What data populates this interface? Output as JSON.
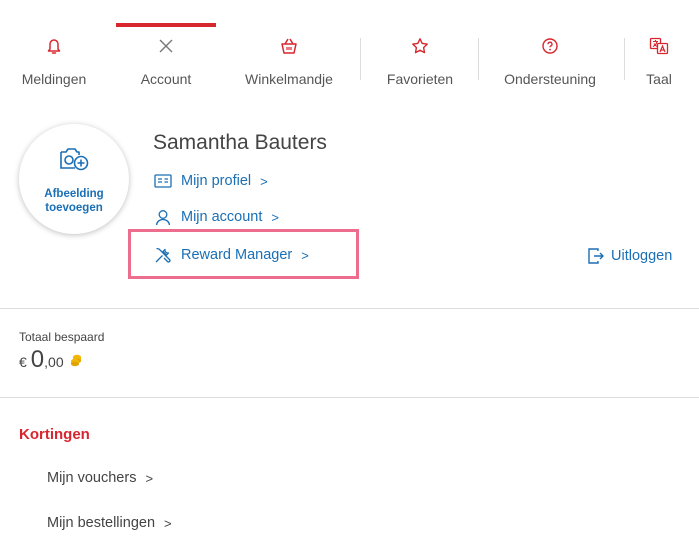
{
  "tabs": [
    {
      "label": "Meldingen",
      "icon": "bell-icon"
    },
    {
      "label": "Account",
      "icon": "close-icon",
      "active": true
    },
    {
      "label": "Winkelmandje",
      "icon": "basket-icon"
    },
    {
      "label": "Favorieten",
      "icon": "star-icon"
    },
    {
      "label": "Ondersteuning",
      "icon": "help-icon"
    },
    {
      "label": "Taal",
      "icon": "language-icon"
    }
  ],
  "profile": {
    "avatar_label": "Afbeelding toevoegen",
    "name": "Samantha Bauters",
    "links": {
      "profile": "Mijn profiel",
      "account": "Mijn account",
      "reward": "Reward Manager"
    },
    "logout": "Uitloggen",
    "chevron": ">"
  },
  "savings": {
    "label": "Totaal bespaard",
    "currency": "€",
    "integer": "0",
    "decimals": ",00"
  },
  "discounts": {
    "heading": "Kortingen",
    "links": [
      "Mijn vouchers",
      "Mijn bestellingen"
    ]
  },
  "colors": {
    "accent": "#d8262e",
    "link": "#1a6fb5",
    "highlight": "#ec6d8d",
    "coin": "#f2b705"
  }
}
